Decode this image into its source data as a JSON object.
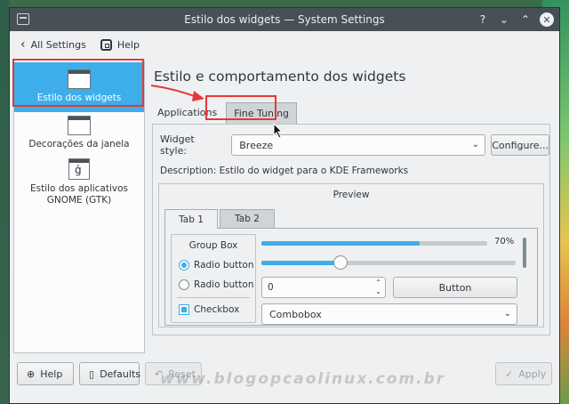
{
  "window": {
    "title": "Estilo dos widgets — System Settings",
    "controls": {
      "help": "?",
      "minimize": "⌄",
      "maximize": "⌃",
      "close": "✕"
    }
  },
  "toolbar": {
    "all_settings": "All Settings",
    "help": "Help"
  },
  "sidebar": {
    "items": [
      {
        "label": "Estilo dos widgets",
        "active": true
      },
      {
        "label": "Decorações da janela",
        "active": false
      },
      {
        "label": "Estilo dos aplicativos GNOME (GTK)",
        "active": false
      }
    ]
  },
  "main": {
    "title": "Estilo e comportamento dos widgets",
    "tabs": [
      {
        "label": "Applications",
        "active": true
      },
      {
        "label": "Fine Tuning",
        "active": false
      }
    ],
    "widget_style_label": "Widget style:",
    "widget_style_value": "Breeze",
    "configure_label": "Configure...",
    "description": "Description: Estilo do widget para o KDE Frameworks"
  },
  "preview": {
    "title": "Preview",
    "tabs": [
      "Tab 1",
      "Tab 2"
    ],
    "group_box_title": "Group Box",
    "radio1": "Radio button",
    "radio2": "Radio button",
    "checkbox": "Checkbox",
    "progress_percent": 70,
    "progress_label": "70%",
    "slider_fraction": 0.31,
    "spin_value": "0",
    "button_label": "Button",
    "combobox_value": "Combobox"
  },
  "footer": {
    "help": "Help",
    "defaults": "Defaults",
    "reset": "Reset",
    "apply": "Apply"
  },
  "watermark": "www.blogopcaolinux.com.br",
  "colors": {
    "accent": "#3daee9",
    "titlebar": "#475057",
    "annotation_red": "#e53935"
  }
}
